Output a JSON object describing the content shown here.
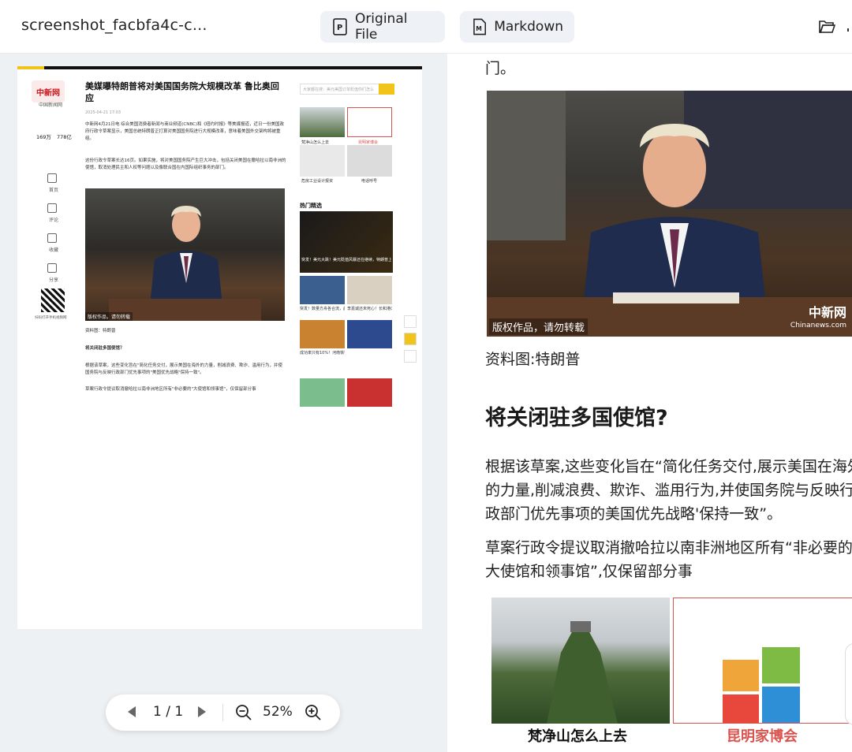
{
  "topbar": {
    "file_title": "screenshot_facbfa4c-c...",
    "tabs": [
      {
        "label": "Original File",
        "icon": "pdf-file-icon"
      },
      {
        "label": "Markdown",
        "icon": "markdown-file-icon"
      }
    ],
    "folder_icon": "folder-open-icon"
  },
  "preview": {
    "logo_text": "中新网",
    "site_name": "中国新闻网",
    "stats": {
      "left": "169万",
      "right": "778亿"
    },
    "headline": "美媒曝特朗普将对美国国务院大规模改革 鲁比奥回应",
    "meta": "2025-04-21 17:03",
    "para1": "中新网4月21日电 综合美国消费者新闻与商业频道(CNBC)和《纽约时报》等美媒报道，近日一份美国政府行政令草案显示，美国总统特朗普正打算对美国国务院进行大规模改革，意味着美国外交架构将被重组。",
    "para2": "这份行政令草案长达16页。如果实施，将对美国国务院产生巨大冲击，包括关闭美国在撒哈拉以南非洲的使馆，取消处理民主和人权等问题以及像联合国在内国际组织事务的部门。",
    "photo_caption": "版权作品，请勿转载",
    "caption": "资料图：特朗普",
    "subhead": "将关闭驻多国使馆？",
    "para3": "根据该草案，这些变化旨在\"简化任务交付，展示美国在海外的力量，削减浪费、欺诈、滥用行为，并使国务院与反映行政部门优先事项的\"美国优先战略\"保持一致\"。",
    "para4": "草案行政令提议取消撤哈拉以南非洲地区所有\"非必要的\"大使馆和领事馆\"，仅保留部分事",
    "search_placeholder": "大家都在搜：美元美国订单贬值你们怎么",
    "hot_label": "热门精选",
    "side_items": [
      "首页",
      "评论",
      "收藏",
      "分享"
    ],
    "thumb_labels": [
      "梵净山怎么上去",
      "昆明家博会",
      "危房工业设计报资",
      "电话呼号"
    ],
    "hot_captions": [
      "突发！美元大跌！美元贬值风暴还在继续，特朗普上台后已跌10%！高盛...",
      "突发！数量方舟各合流，此前观见花...",
      "李嘉诚还未死心！长和港口买家突然换人...",
      "成功率只有10%！河南铁锤团结看似..."
    ],
    "qr_caption": "扫码打开手机视频网"
  },
  "pager": {
    "page_count": "1 / 1",
    "zoom": "52%"
  },
  "markdown": {
    "top_fragment": "门。",
    "photo_caption": "版权作品，请勿转载",
    "photo_logo": "中新网",
    "photo_logo_sub": "Chinanews.com",
    "caption": "资料图:特朗普",
    "heading": "将关闭驻多国使馆?",
    "para1_lines": [
      "根据该草案,这些变化旨在“简化任务交付,展示美国在海外",
      "的力量,削减浪费、欺诈、滥用行为,并使国务院与反映行",
      "政部门优先事项的美国优先战略'保持一致”。"
    ],
    "para2_lines": [
      "草案行政令提议取消撤哈拉以南非洲地区所有“非必要的",
      "大使馆和领事馆”,仅保留部分事"
    ],
    "image_captions": [
      "梵净山怎么上去",
      "昆明家博会"
    ]
  }
}
